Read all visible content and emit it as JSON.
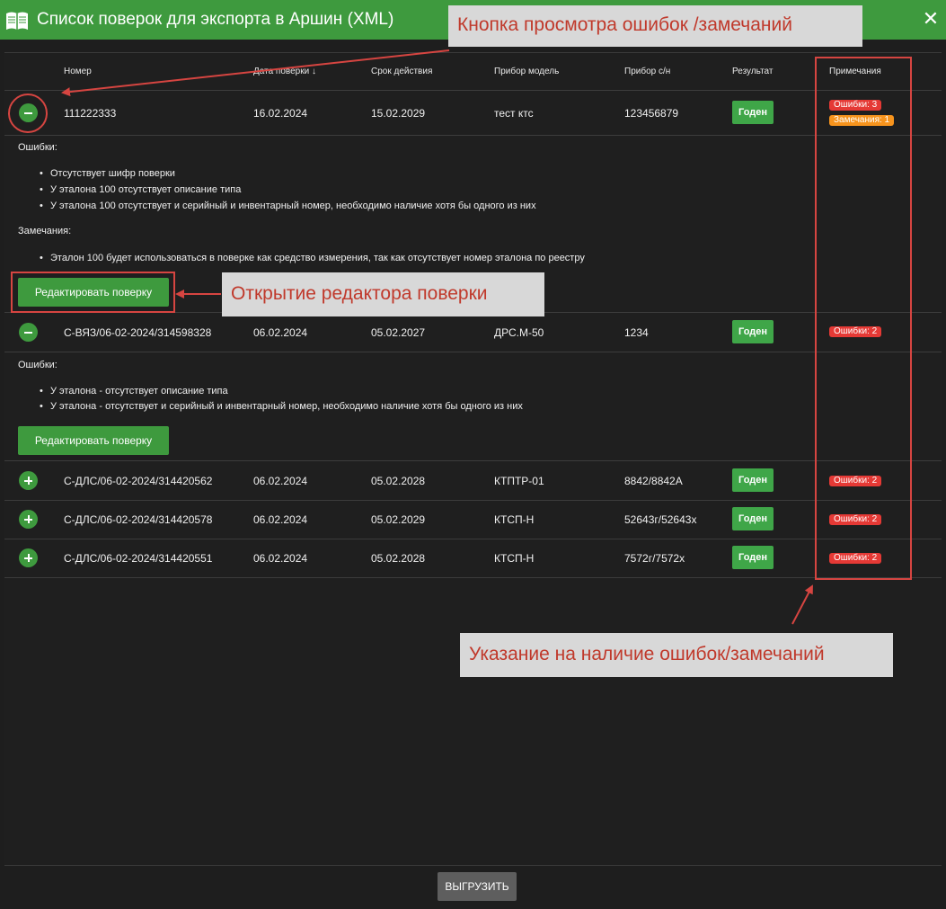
{
  "window": {
    "title": "Список поверок для экспорта в Аршин (XML)",
    "close_label": "✕",
    "accent": "#3e9a3e"
  },
  "table": {
    "headers": [
      "Номер",
      "Дата поверки",
      "Срок действия",
      "Прибор модель",
      "Прибор с/н",
      "Результат",
      "Примечания"
    ],
    "sort_indicator": "↓",
    "rows": [
      {
        "number": "111222333",
        "date": "16.02.2024",
        "valid_until": "15.02.2029",
        "model": "тест ктс",
        "serial": "123456879",
        "result": "Годен",
        "expanded": true,
        "badges": [
          {
            "text": "Ошибки: 3",
            "kind": "error"
          },
          {
            "text": "Замечания: 1",
            "kind": "warning"
          }
        ],
        "errors_label": "Ошибки:",
        "errors": [
          "Отсутствует шифр поверки",
          "У эталона 100 отсутствует описание типа",
          "У эталона 100 отсутствует и серийный и инвентарный номер, необходимо наличие хотя бы одного из них"
        ],
        "remarks_label": "Замечания:",
        "remarks": [
          "Эталон 100 будет использоваться в поверке как средство измерения, так как отсутствует номер эталона по реестру"
        ],
        "edit_label": "Редактировать поверку"
      },
      {
        "number": "С-ВЯЗ/06-02-2024/314598328",
        "date": "06.02.2024",
        "valid_until": "05.02.2027",
        "model": "ДРС.М-50",
        "serial": "1234",
        "result": "Годен",
        "expanded": true,
        "badges": [
          {
            "text": "Ошибки: 2",
            "kind": "error"
          }
        ],
        "errors_label": "Ошибки:",
        "errors": [
          "У эталона - отсутствует описание типа",
          "У эталона - отсутствует и серийный и инвентарный номер, необходимо наличие хотя бы одного из них"
        ],
        "edit_label": "Редактировать поверку"
      },
      {
        "number": "С-ДЛС/06-02-2024/314420562",
        "date": "06.02.2024",
        "valid_until": "05.02.2028",
        "model": "КТПТР-01",
        "serial": "8842/8842А",
        "result": "Годен",
        "expanded": false,
        "badges": [
          {
            "text": "Ошибки: 2",
            "kind": "error"
          }
        ]
      },
      {
        "number": "С-ДЛС/06-02-2024/314420578",
        "date": "06.02.2024",
        "valid_until": "05.02.2029",
        "model": "КТСП-Н",
        "serial": "52643г/52643х",
        "result": "Годен",
        "expanded": false,
        "badges": [
          {
            "text": "Ошибки: 2",
            "kind": "error"
          }
        ]
      },
      {
        "number": "С-ДЛС/06-02-2024/314420551",
        "date": "06.02.2024",
        "valid_until": "05.02.2028",
        "model": "КТСП-Н",
        "serial": "7572г/7572х",
        "result": "Годен",
        "expanded": false,
        "badges": [
          {
            "text": "Ошибки: 2",
            "kind": "error"
          }
        ]
      }
    ]
  },
  "footer": {
    "export_label": "ВЫГРУЗИТЬ"
  },
  "annotations": {
    "view_button": "Кнопка просмотра ошибок /замечаний",
    "open_editor": "Открытие редактора поверки",
    "indicator": "Указание на наличие ошибок/замечаний",
    "color": "#d64541"
  }
}
